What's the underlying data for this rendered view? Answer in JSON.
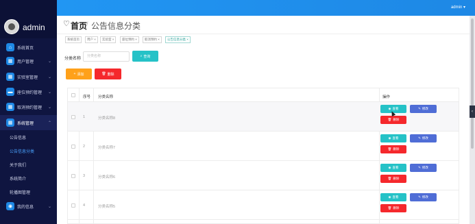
{
  "brand": {
    "name": "admin"
  },
  "topbar": {
    "user": "admin ▾"
  },
  "sidebar": {
    "items": [
      {
        "label": "系统首页",
        "icon": "home-icon"
      },
      {
        "label": "用户管理",
        "icon": "grid-icon"
      },
      {
        "label": "实验室管理",
        "icon": "grid-icon"
      },
      {
        "label": "座位预约管理",
        "icon": "chat-icon"
      },
      {
        "label": "取消预约管理",
        "icon": "grid-icon"
      },
      {
        "label": "系统管理",
        "icon": "grid-icon"
      }
    ],
    "subitems": [
      "公告信息",
      "公告信息分类",
      "关于我们",
      "系统简介",
      "轮播图管理"
    ],
    "last": {
      "label": "我的信息",
      "icon": "user-icon"
    }
  },
  "breadcrumb": {
    "home": "首页",
    "current": "公告信息分类"
  },
  "tags": [
    "系统首页",
    "用户 ×",
    "实验室 ×",
    "座位预约 ×",
    "取消预约 ×",
    "公告信息分类 ×"
  ],
  "filter": {
    "label": "分类名称",
    "placeholder": "分类名称",
    "search": "查询"
  },
  "toolbar": {
    "add": "添加",
    "delete": "删除"
  },
  "table": {
    "headers": {
      "no": "序号",
      "name": "分类名称",
      "ops": "操作"
    },
    "rows": [
      {
        "no": "1",
        "name": "分类名称8"
      },
      {
        "no": "2",
        "name": "分类名称7"
      },
      {
        "no": "3",
        "name": "分类名称6"
      },
      {
        "no": "4",
        "name": "分类名称5"
      }
    ],
    "actions": {
      "view": "查看",
      "edit": "修改",
      "delete": "删除"
    }
  },
  "colors": {
    "sidebar": "#0f1540",
    "topbar": "#1e88e5",
    "view": "#25c2c7",
    "edit": "#4f6dd6",
    "delete": "#f5282c",
    "add": "#ffa11a"
  }
}
